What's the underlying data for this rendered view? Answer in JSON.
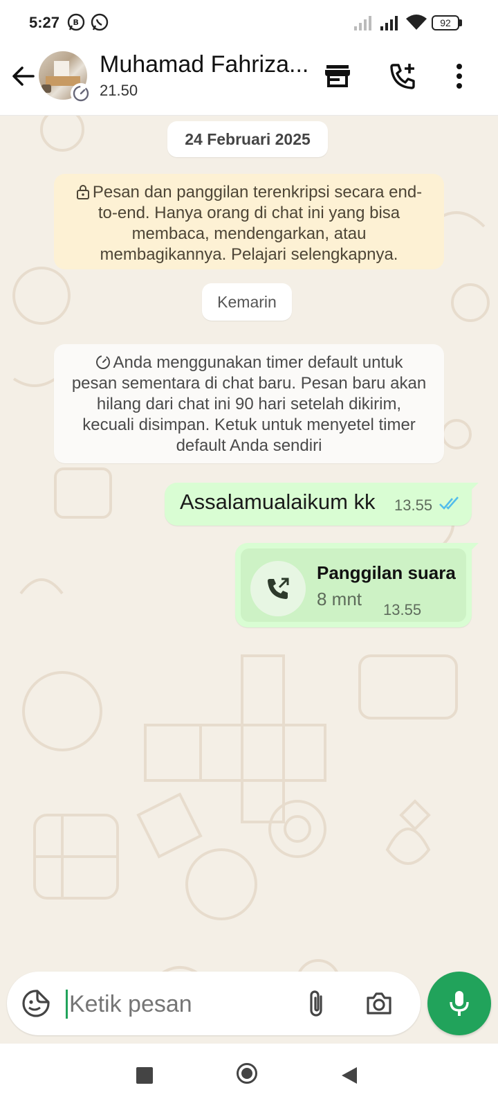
{
  "status_bar": {
    "time": "5:27",
    "battery": "92",
    "icons": [
      "whatsapp-business-icon",
      "whatsapp-icon",
      "signal-icon",
      "signal-icon",
      "wifi-icon",
      "battery-icon"
    ]
  },
  "header": {
    "contact_name": "Muhamad Fahriza...",
    "subtitle": "21.50",
    "icons": [
      "back-arrow-icon",
      "store-icon",
      "add-call-icon",
      "more-vert-icon"
    ]
  },
  "chat": {
    "date_pill": "24 Februari 2025",
    "encryption_notice": "Pesan dan panggilan terenkripsi secara end-to-end. Hanya orang di chat ini yang bisa membaca, mendengarkan, atau membagikannya. Pelajari selengkapnya.",
    "yesterday_pill": "Kemarin",
    "timer_notice": "Anda menggunakan timer default untuk pesan sementara di chat baru. Pesan baru akan hilang dari chat ini 90 hari setelah dikirim, kecuali disimpan. Ketuk untuk menyetel timer default Anda sendiri",
    "messages": [
      {
        "text": "Assalamualaikum kk",
        "time": "13.55"
      },
      {
        "call_title": "Panggilan suara",
        "call_duration": "8 mnt",
        "time": "13.55"
      }
    ]
  },
  "input": {
    "placeholder": "Ketik pesan"
  },
  "colors": {
    "accent_green": "#21a35b",
    "outgoing_bubble": "#d9fdd3",
    "read_ticks": "#53bdeb",
    "encryption_bg": "#fdf1d4"
  }
}
